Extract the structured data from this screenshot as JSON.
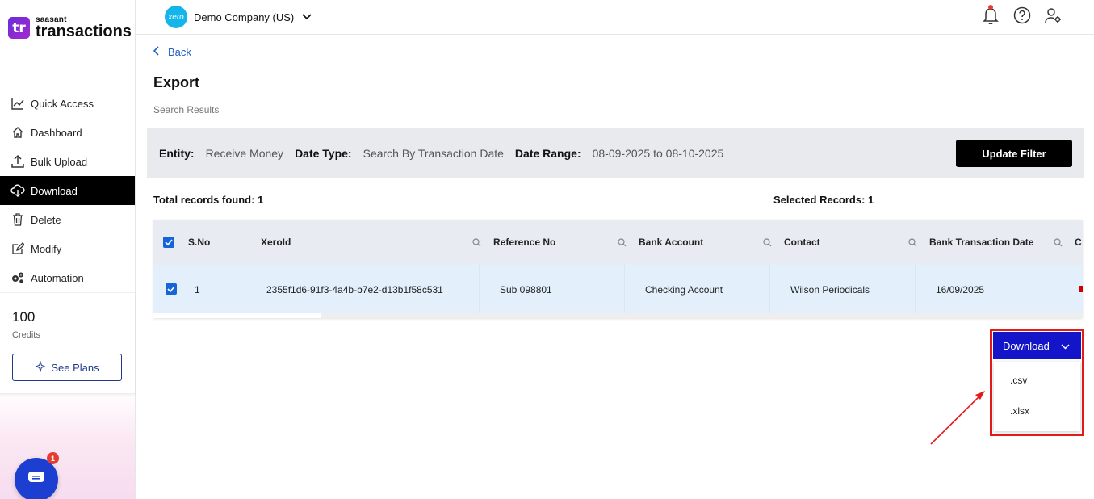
{
  "brand": {
    "small": "saasant",
    "big": "transactions",
    "logo_text": "tr"
  },
  "sidebar": {
    "items": [
      {
        "label": "Quick Access",
        "icon": "chart-line-icon"
      },
      {
        "label": "Dashboard",
        "icon": "home-icon"
      },
      {
        "label": "Bulk Upload",
        "icon": "upload-icon"
      },
      {
        "label": "Download",
        "icon": "cloud-download-icon",
        "active": true
      },
      {
        "label": "Delete",
        "icon": "trash-icon"
      },
      {
        "label": "Modify",
        "icon": "edit-icon"
      },
      {
        "label": "Automation",
        "icon": "gears-icon"
      }
    ],
    "credits_value": "100",
    "credits_label": "Credits",
    "see_plans": "See Plans",
    "chat_badge": "1"
  },
  "header": {
    "company_logo": "xero",
    "company_name": "Demo Company (US)"
  },
  "main": {
    "back": "Back",
    "title": "Export",
    "subtitle": "Search Results",
    "filter": {
      "entity_label": "Entity:",
      "entity_value": "Receive Money",
      "date_type_label": "Date Type:",
      "date_type_value": "Search By Transaction Date",
      "date_range_label": "Date Range:",
      "date_range_value": "08-09-2025 to 08-10-2025",
      "update_button": "Update Filter"
    },
    "total_records": "Total records found: 1",
    "selected_records": "Selected Records: 1",
    "table": {
      "headers": [
        "S.No",
        "XeroId",
        "Reference No",
        "Bank Account",
        "Contact",
        "Bank Transaction Date",
        "C"
      ],
      "rows": [
        {
          "sno": "1",
          "xeroid": "2355f1d6-91f3-4a4b-b7e2-d13b1f58c531",
          "reference": "Sub 098801",
          "bank_account": "Checking Account",
          "contact": "Wilson Periodicals",
          "date": "16/09/2025"
        }
      ]
    }
  },
  "download": {
    "button": "Download",
    "options": [
      ".csv",
      ".xlsx"
    ]
  },
  "colors": {
    "accent": "#1414c8",
    "highlight": "#e41b1b",
    "active_nav": "#000000",
    "row_selected": "#e3f0fb"
  }
}
